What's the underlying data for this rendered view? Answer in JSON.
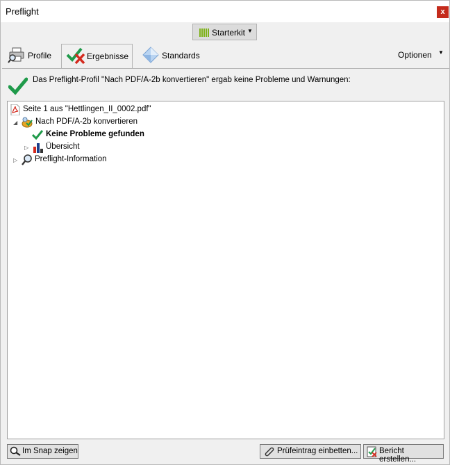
{
  "window": {
    "title": "Preflight",
    "close_label": "x"
  },
  "library": {
    "label": "Starterkit"
  },
  "tabs": [
    {
      "label": "Profile"
    },
    {
      "label": "Ergebnisse"
    },
    {
      "label": "Standards"
    }
  ],
  "options_label": "Optionen",
  "summary": "Das Preflight-Profil \"Nach PDF/A-2b konvertieren\" ergab keine Probleme und Warnungen:",
  "tree": {
    "root": "Seite 1 aus \"Hettlingen_II_0002.pdf\"",
    "profile": "Nach PDF/A-2b konvertieren",
    "no_problems": "Keine Probleme gefunden",
    "overview": "Übersicht",
    "preflight_info": "Preflight-Information"
  },
  "buttons": {
    "snap": "Im Snap zeigen",
    "embed": "Prüfeintrag einbetten...",
    "report": "Bericht erstellen..."
  },
  "colors": {
    "check": "#1f9a4a",
    "close": "#c42b1c",
    "pdf": "#d42a1e"
  }
}
